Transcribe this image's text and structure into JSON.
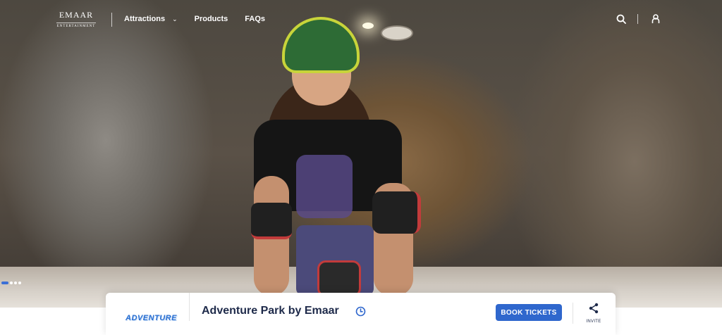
{
  "header": {
    "logo": {
      "brand": "EMAAR",
      "sub": "ENTERTAINMENT"
    },
    "nav": [
      {
        "label": "Attractions",
        "has_dropdown": true
      },
      {
        "label": "Products"
      },
      {
        "label": "FAQs"
      }
    ],
    "icons": [
      "search-icon",
      "user-icon"
    ]
  },
  "hero": {
    "carousel": {
      "slides": 3,
      "active": 1
    }
  },
  "card": {
    "logo_text": "ADVENTURE",
    "title": "Adventure Park by Emaar",
    "book_label": "BOOK TICKETS",
    "share_label": "INVITE"
  },
  "colors": {
    "accent": "#2f67cd",
    "title": "#1e2a4a",
    "header_text": "#ffffff"
  }
}
